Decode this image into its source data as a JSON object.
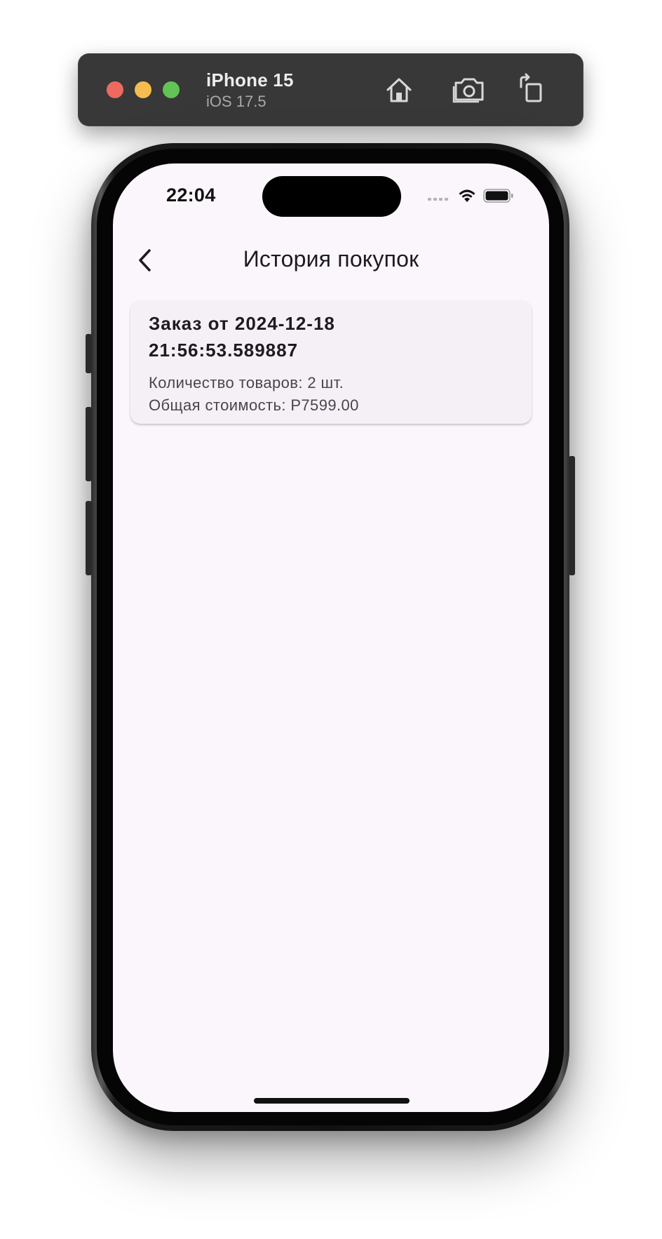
{
  "simulator": {
    "device_name": "iPhone 15",
    "os_version": "iOS 17.5",
    "toolbar_icons": [
      "home-icon",
      "screenshot-icon",
      "rotate-icon"
    ]
  },
  "status_bar": {
    "time": "22:04",
    "icons": [
      "cellular-signal-icon",
      "wifi-icon",
      "battery-icon"
    ]
  },
  "app_bar": {
    "back_icon": "chevron-left-icon",
    "title": "История покупок"
  },
  "orders": [
    {
      "title": "Заказ от 2024-12-18 21:56:53.589887",
      "items_count": "Количество товаров: 2 шт.",
      "total": "Общая стоимость: Р7599.00"
    }
  ],
  "colors": {
    "screen_background": "#fbf6fb",
    "card_background": "#f4f0f5",
    "primary_text": "#1d1b20",
    "secondary_text": "#49454f",
    "toolbar_background": "#383838"
  }
}
